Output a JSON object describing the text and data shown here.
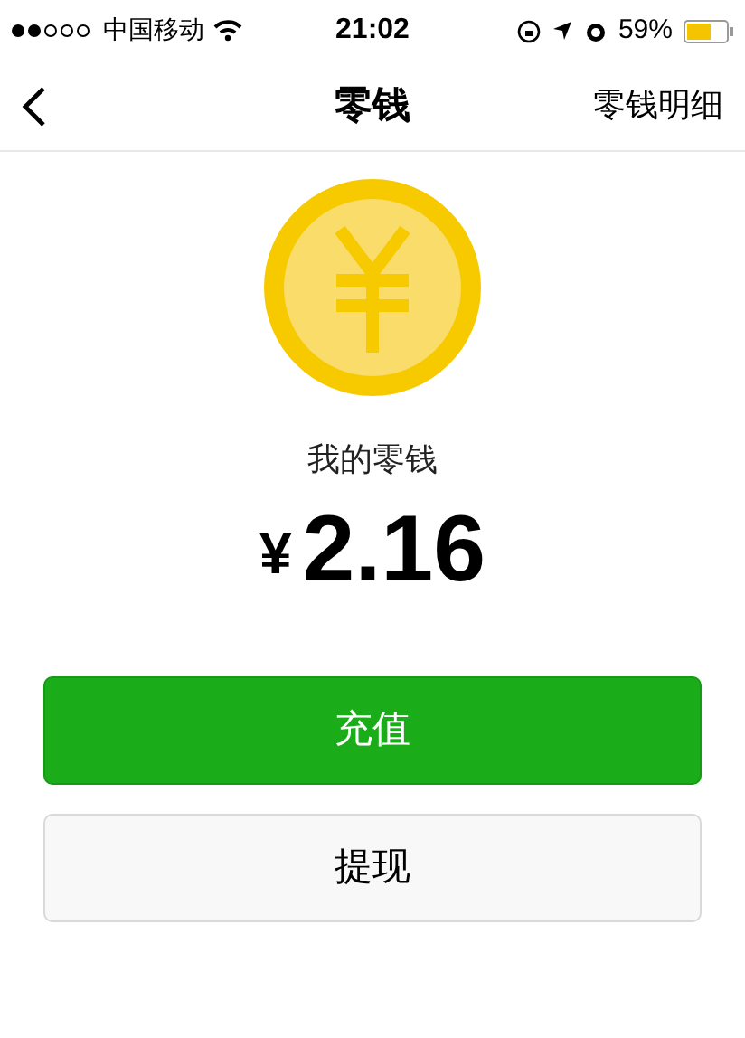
{
  "status_bar": {
    "carrier": "中国移动",
    "time": "21:02",
    "battery": "59%"
  },
  "nav": {
    "title": "零钱",
    "action": "零钱明细"
  },
  "balance": {
    "label": "我的零钱",
    "currency": "¥",
    "amount": "2.16"
  },
  "buttons": [
    {
      "label": "充值",
      "kind": "primary"
    },
    {
      "label": "提现",
      "kind": "secondary"
    }
  ]
}
